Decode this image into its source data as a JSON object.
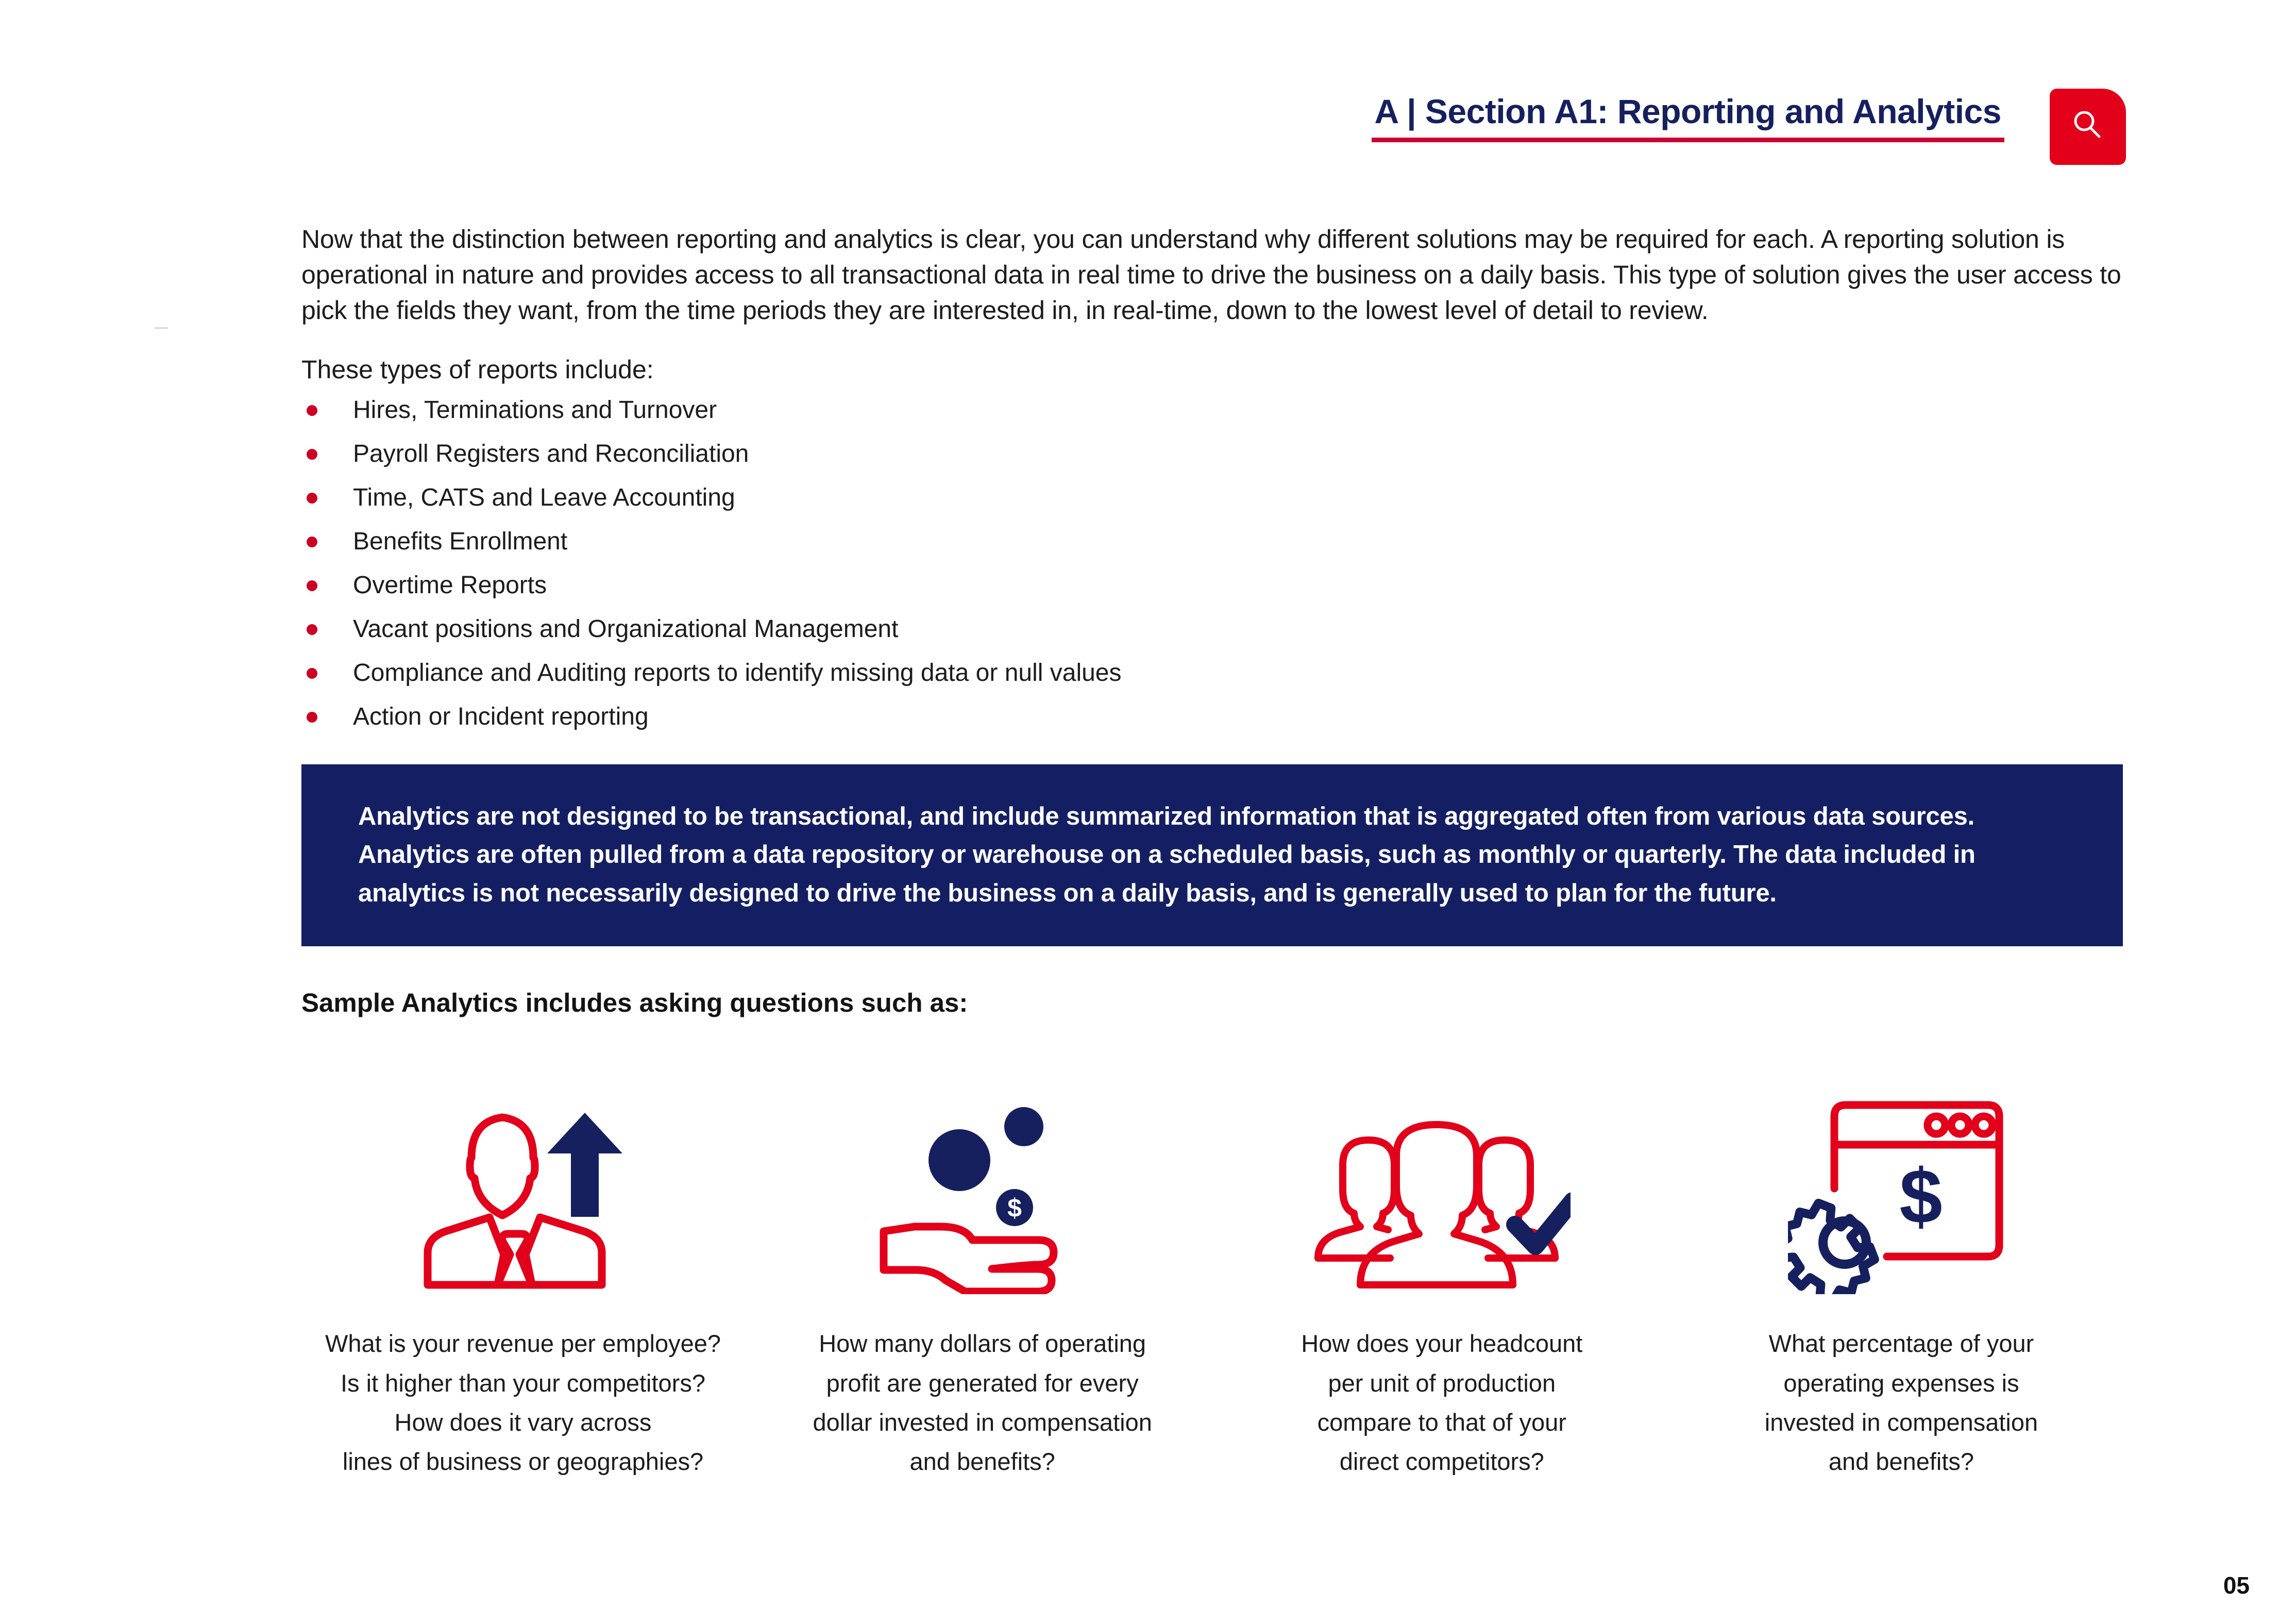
{
  "header": {
    "title": "A | Section A1: Reporting and Analytics",
    "search_icon": "search-icon",
    "accent_underline_color": "#cc0033",
    "title_color": "#16205e",
    "search_button_color": "#e2001a"
  },
  "body": {
    "intro_paragraph": "Now that the distinction between reporting and analytics is clear, you can understand why different solutions may be required for each. A reporting solution is operational in nature and provides access to all transactional data in real time to drive the business on a daily basis. This type of solution gives the user access to pick the fields they want, from the time periods they are interested in, in real-time, down to the lowest level of detail to review.",
    "list_lead_in": "These types of reports include:",
    "bullets": [
      "Hires, Terminations and Turnover",
      "Payroll Registers and Reconciliation",
      "Time, CATS and Leave Accounting",
      "Benefits Enrollment",
      "Overtime Reports",
      "Vacant positions and Organizational Management",
      "Compliance and Auditing reports to identify missing data or null values",
      "Action or Incident reporting"
    ],
    "bullet_color": "#cc0022"
  },
  "callout": {
    "background_color": "#141f63",
    "text_color": "#ffffff",
    "text": "Analytics are not designed to be transactional, and include summarized information that is aggregated often from various data sources. Analytics are often pulled from a data repository or warehouse on a scheduled basis, such as monthly or quarterly. The data included in analytics is not necessarily designed to drive the business on a daily basis, and is generally used to plan for the future."
  },
  "sample_section": {
    "heading": "Sample Analytics includes asking questions such as:",
    "icon_red": "#e2001a",
    "icon_navy": "#16205e",
    "items": [
      {
        "icon_name": "employee-revenue-growth-icon",
        "caption": "What is your revenue per employee?\nIs it higher than your competitors?\nHow does it vary across\nlines of business or geographies?"
      },
      {
        "icon_name": "hand-with-coins-icon",
        "caption": "How many dollars of operating\nprofit are generated for every\ndollar invested in compensation\nand benefits?"
      },
      {
        "icon_name": "people-group-check-icon",
        "caption": "How does your headcount\nper unit of production\ncompare to that of your\ndirect competitors?"
      },
      {
        "icon_name": "browser-dollar-gear-icon",
        "caption": "What percentage of your\noperating expenses is\ninvested in compensation\nand benefits?"
      }
    ]
  },
  "footer": {
    "page_number": "05"
  }
}
